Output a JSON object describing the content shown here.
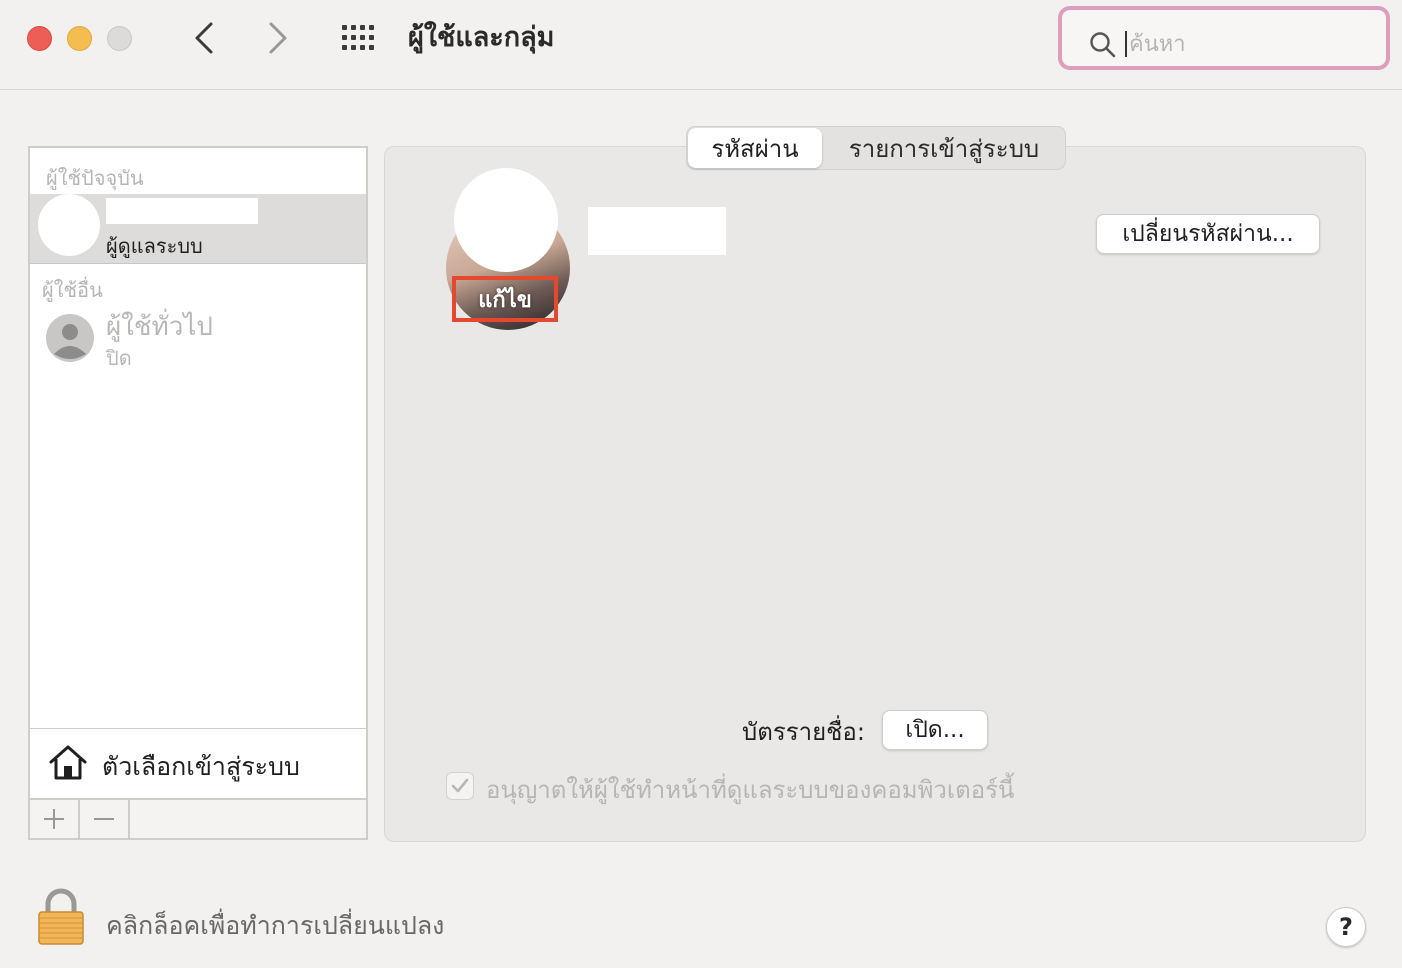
{
  "window": {
    "title": "ผู้ใช้และกลุ่ม"
  },
  "search": {
    "placeholder": "ค้นหา",
    "value": ""
  },
  "sidebar": {
    "current_users_header": "ผู้ใช้ปัจจุบัน",
    "current_user": {
      "role": "ผู้ดูแลระบบ"
    },
    "other_users_header": "ผู้ใช้อื่น",
    "guest_user": {
      "name": "ผู้ใช้ทั่วไป",
      "status": "ปิด"
    },
    "login_options_label": "ตัวเลือกเข้าสู่ระบบ",
    "add_label": "+",
    "remove_label": "—"
  },
  "tabs": [
    {
      "label": "รหัสผ่าน",
      "active": true
    },
    {
      "label": "รายการเข้าสู่ระบบ",
      "active": false
    }
  ],
  "profile": {
    "edit_label": "แก้ไข",
    "change_password_label": "เปลี่ยนรหัสผ่าน...",
    "contact_card_label": "บัตรรายชื่อ:",
    "open_label": "เปิด...",
    "allow_admin_label": "อนุญาตให้ผู้ใช้ทำหน้าที่ดูแลระบบของคอมพิวเตอร์นี้",
    "allow_admin_checked": true
  },
  "footer": {
    "lock_label": "คลิกล็อคเพื่อทำการเปลี่ยนแปลง",
    "help_label": "?"
  },
  "colors": {
    "search_focus_ring": "#dd9dbd",
    "edit_highlight": "#e4482f",
    "close": "#ed5f56",
    "minimize": "#f5bd4f"
  }
}
